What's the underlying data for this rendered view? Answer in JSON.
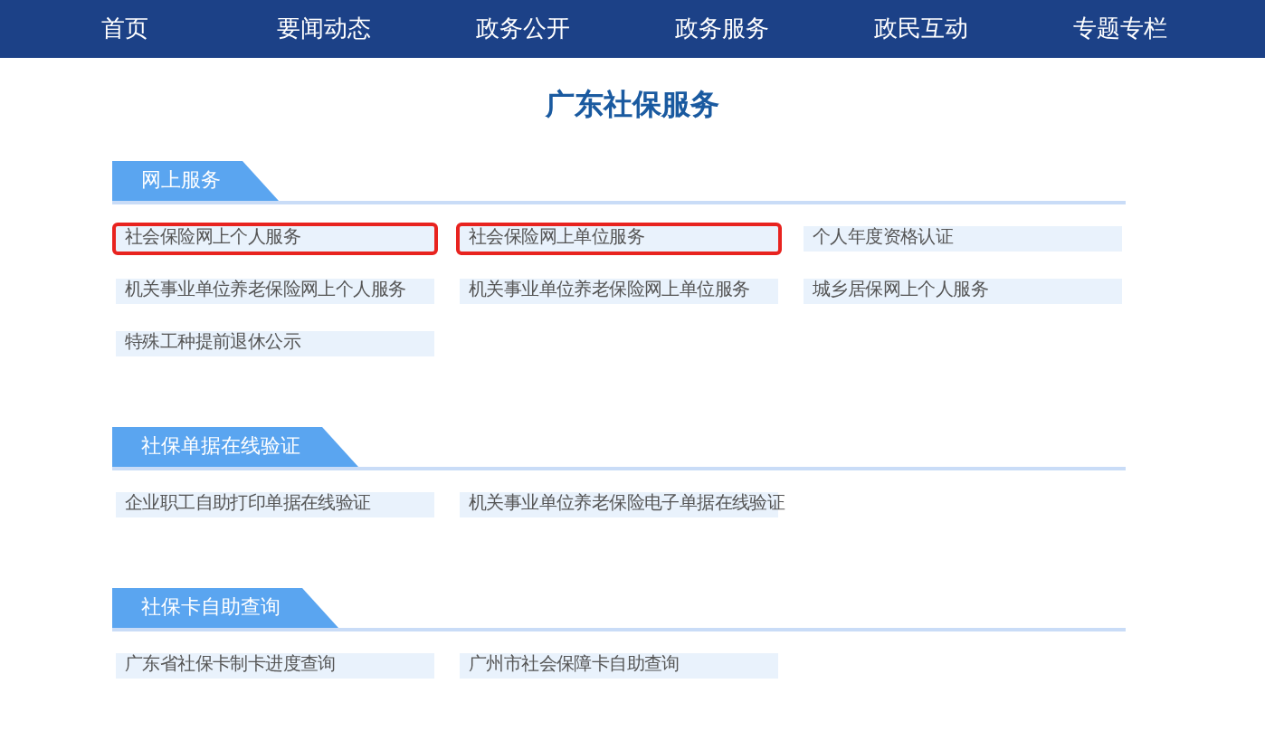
{
  "nav": [
    {
      "label": "首页"
    },
    {
      "label": "要闻动态"
    },
    {
      "label": "政务公开"
    },
    {
      "label": "政务服务"
    },
    {
      "label": "政民互动"
    },
    {
      "label": "专题专栏"
    }
  ],
  "page_title": "广东社保服务",
  "sections": [
    {
      "title": "网上服务",
      "items": [
        {
          "label": "社会保险网上个人服务",
          "highlighted": true
        },
        {
          "label": "社会保险网上单位服务",
          "highlighted": true
        },
        {
          "label": "个人年度资格认证",
          "highlighted": false
        },
        {
          "label": "机关事业单位养老保险网上个人服务",
          "highlighted": false
        },
        {
          "label": "机关事业单位养老保险网上单位服务",
          "highlighted": false
        },
        {
          "label": "城乡居保网上个人服务",
          "highlighted": false
        },
        {
          "label": "特殊工种提前退休公示",
          "highlighted": false
        }
      ]
    },
    {
      "title": "社保单据在线验证",
      "items": [
        {
          "label": "企业职工自助打印单据在线验证",
          "highlighted": false
        },
        {
          "label": "机关事业单位养老保险电子单据在线验证",
          "highlighted": false
        }
      ]
    },
    {
      "title": "社保卡自助查询",
      "items": [
        {
          "label": "广东省社保卡制卡进度查询",
          "highlighted": false
        },
        {
          "label": "广州市社会保障卡自助查询",
          "highlighted": false
        }
      ]
    }
  ]
}
